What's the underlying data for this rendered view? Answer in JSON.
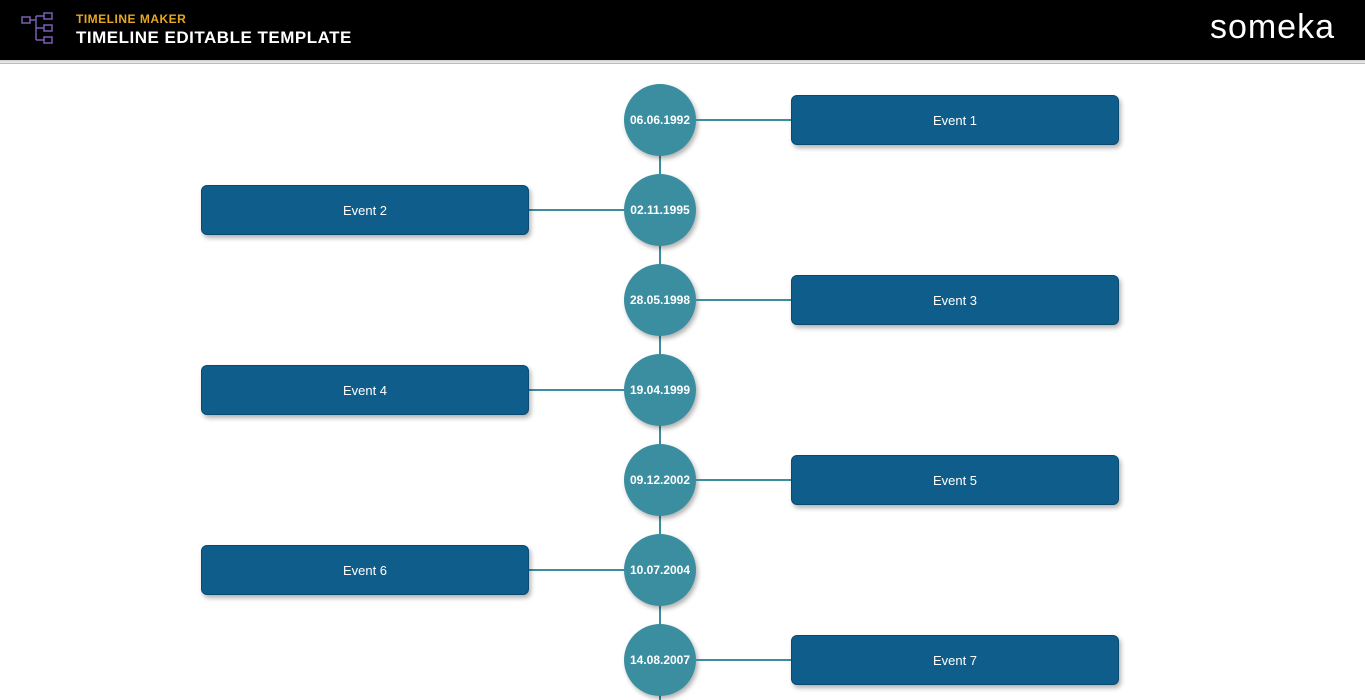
{
  "header": {
    "small_title": "TIMELINE MAKER",
    "big_title": "TIMELINE EDITABLE TEMPLATE",
    "brand": "someka"
  },
  "timeline": {
    "events": [
      {
        "date": "06.06.1992",
        "label": "Event 1",
        "side": "right"
      },
      {
        "date": "02.11.1995",
        "label": "Event 2",
        "side": "left"
      },
      {
        "date": "28.05.1998",
        "label": "Event 3",
        "side": "right"
      },
      {
        "date": "19.04.1999",
        "label": "Event 4",
        "side": "left"
      },
      {
        "date": "09.12.2002",
        "label": "Event 5",
        "side": "right"
      },
      {
        "date": "10.07.2004",
        "label": "Event 6",
        "side": "left"
      },
      {
        "date": "14.08.2007",
        "label": "Event 7",
        "side": "right"
      }
    ]
  }
}
